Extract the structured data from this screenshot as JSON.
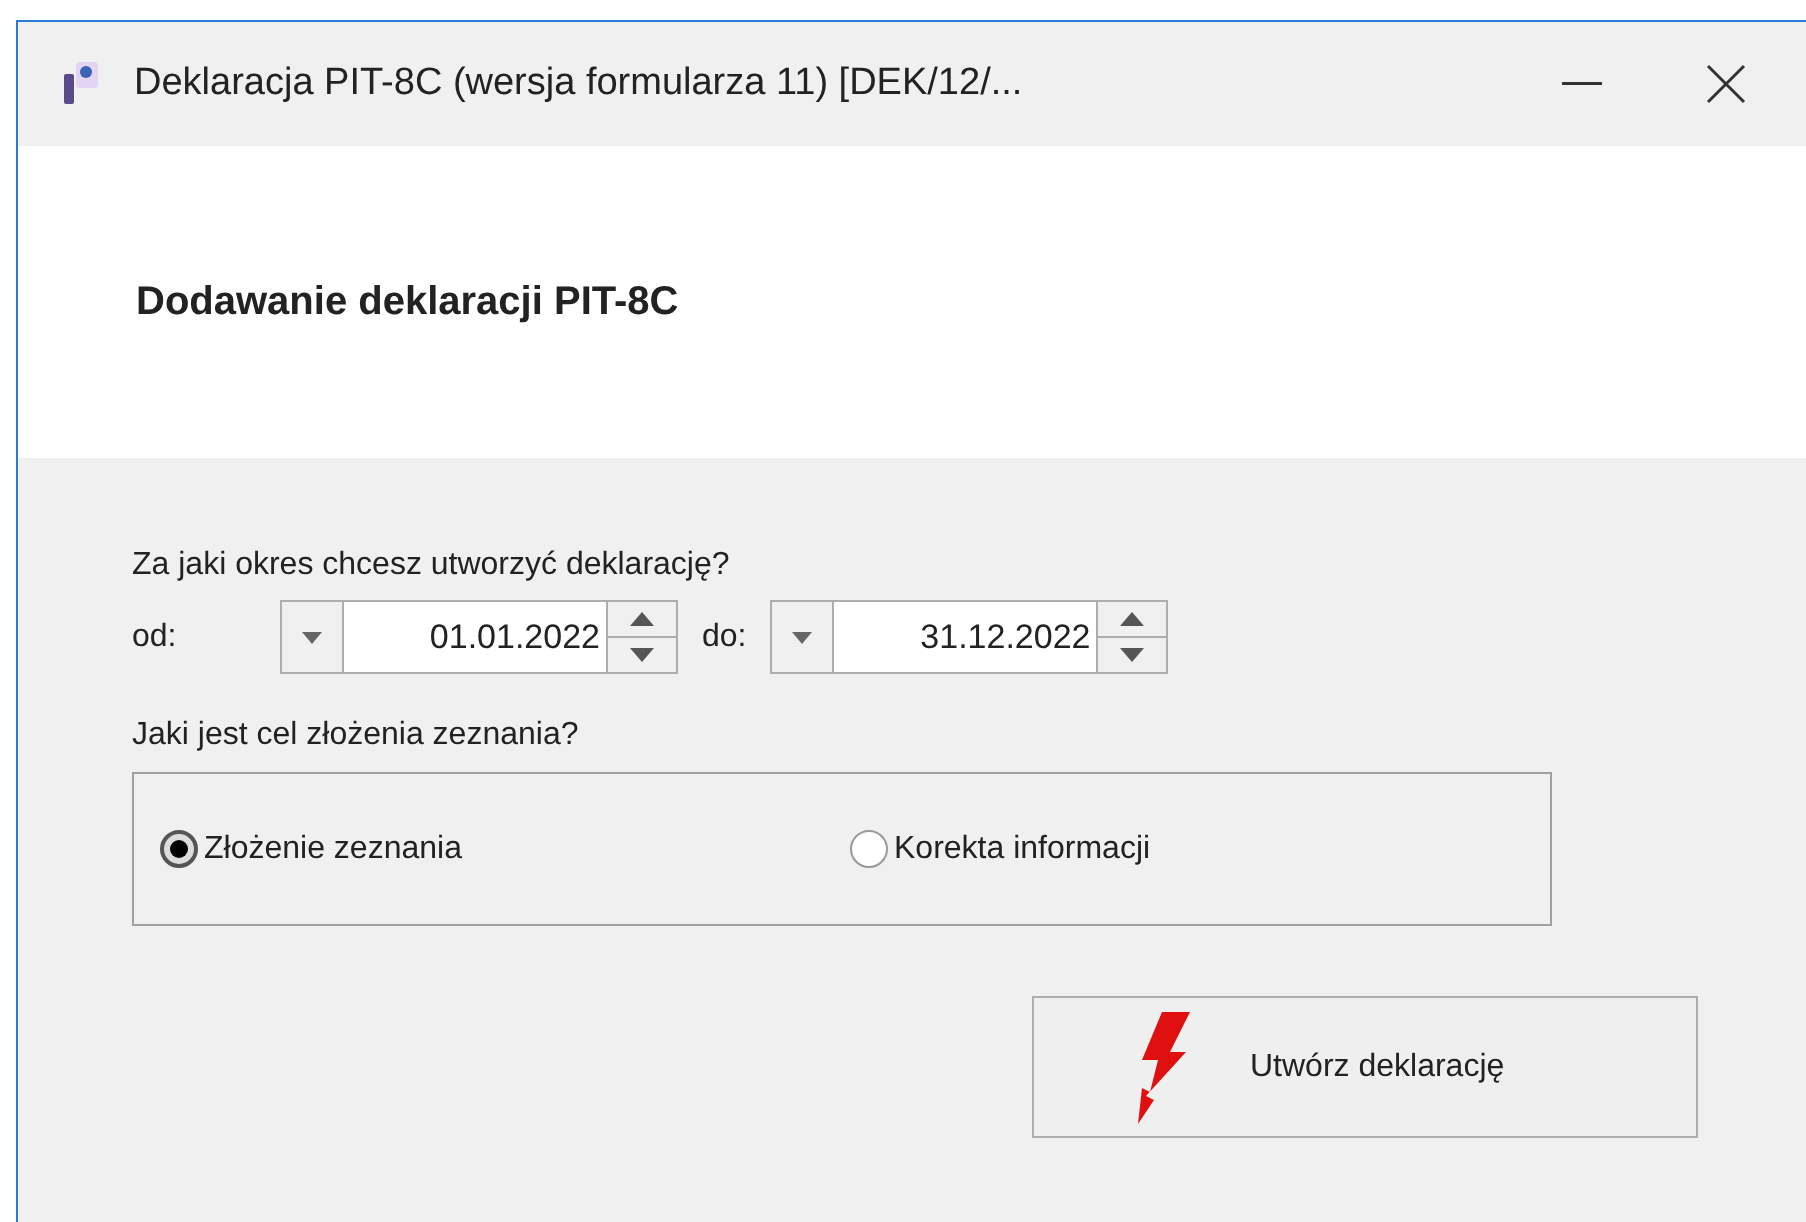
{
  "window": {
    "title": "Deklaracja PIT-8C (wersja formularza 11) [DEK/12/..."
  },
  "header": {
    "title": "Dodawanie deklaracji PIT-8C"
  },
  "period": {
    "question": "Za jaki okres chcesz utworzyć deklarację?",
    "fields": [
      {
        "label": "od:",
        "value": "01.01.2022"
      },
      {
        "label": "do:",
        "value": "31.12.2022"
      }
    ]
  },
  "purpose": {
    "question": "Jaki jest cel złożenia zeznania?",
    "options": [
      {
        "label": "Złożenie zeznania",
        "selected": true
      },
      {
        "label": "Korekta informacji",
        "selected": false
      }
    ]
  },
  "create_button": {
    "label": "Utwórz deklarację"
  }
}
